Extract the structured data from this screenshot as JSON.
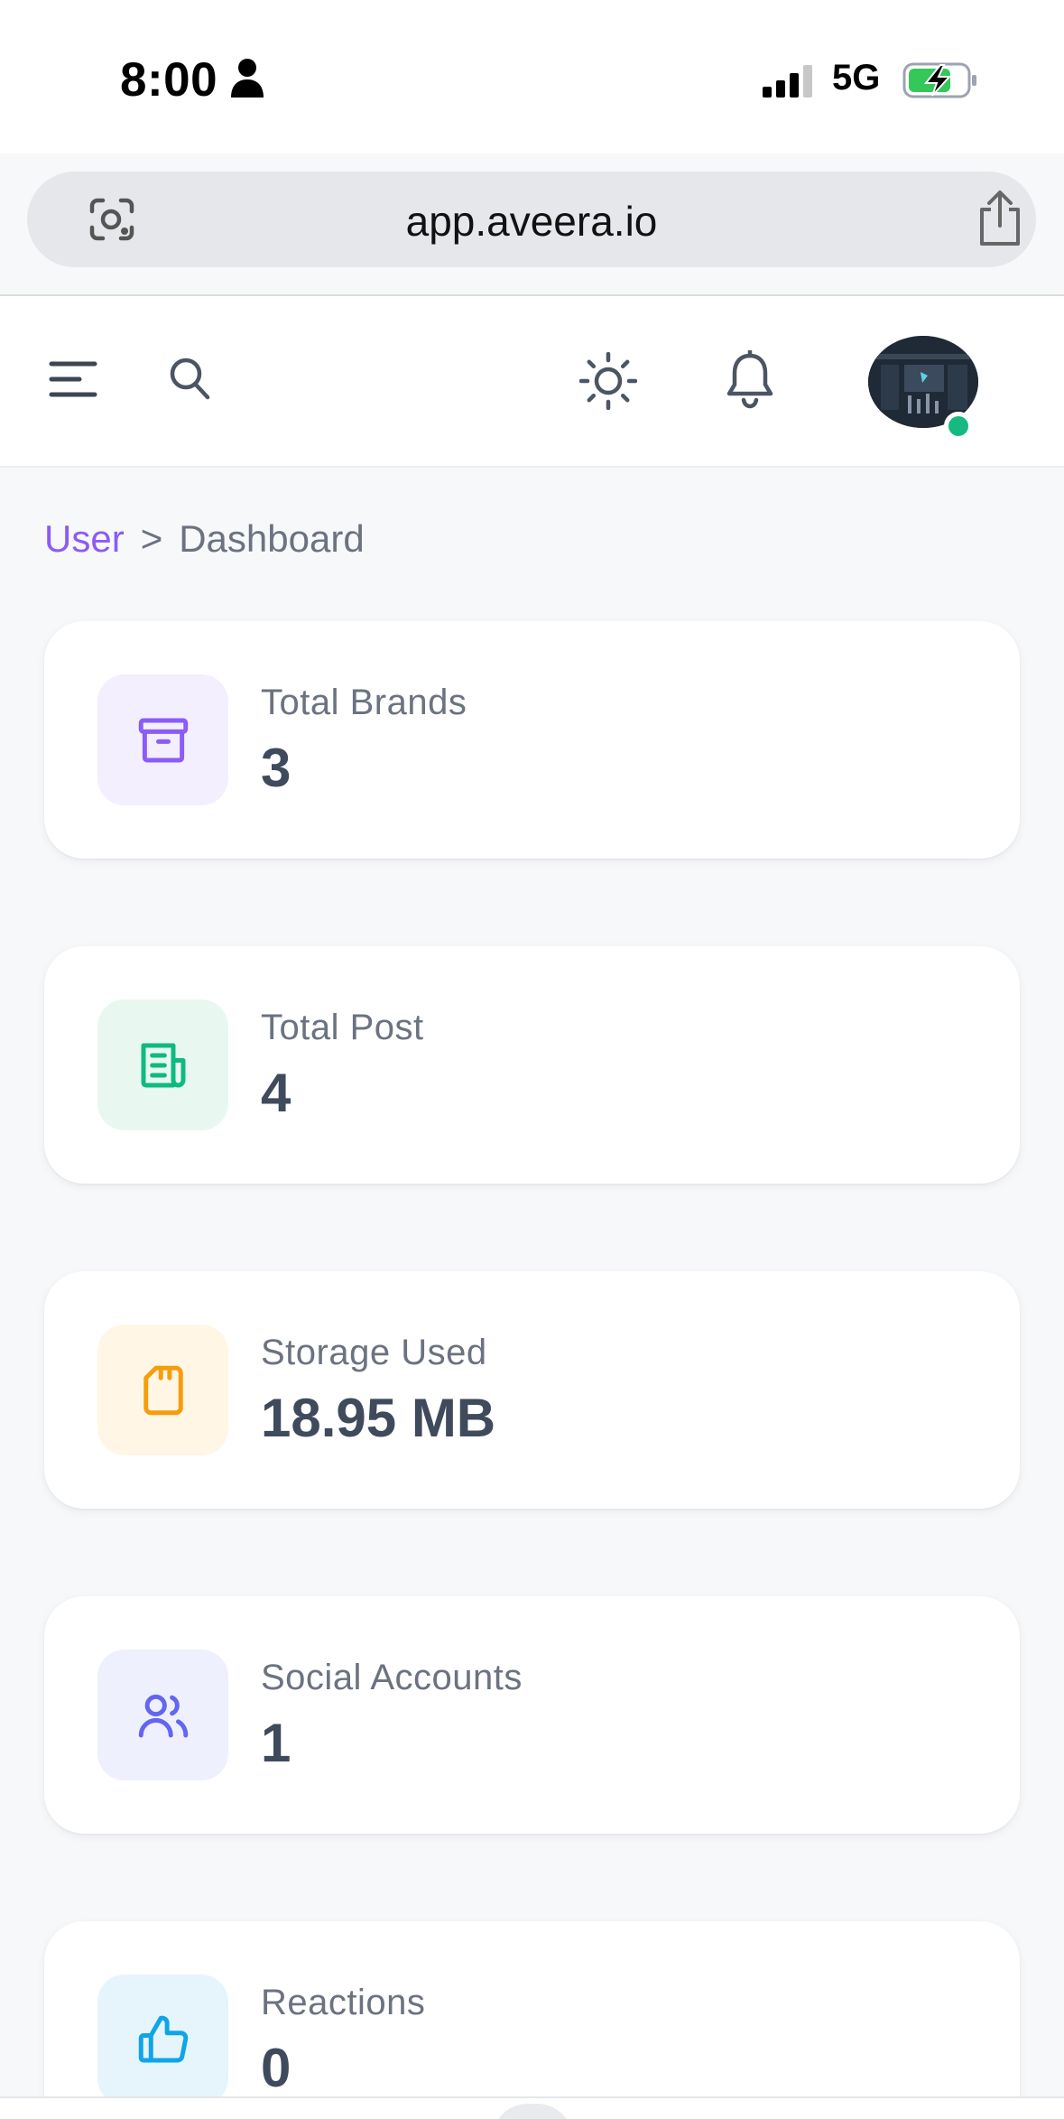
{
  "status_bar": {
    "time": "8:00",
    "network": "5G"
  },
  "browser": {
    "url": "app.aveera.io"
  },
  "breadcrumb": {
    "parent": "User",
    "separator": ">",
    "current": "Dashboard"
  },
  "colors": {
    "accent_purple": "#8b5cf6",
    "online_green": "#16b981"
  },
  "cards": [
    {
      "label": "Total Brands",
      "value": "3",
      "icon": "archive-box-icon",
      "icon_color": "#8b5cf6",
      "icon_bg": "#f3efff"
    },
    {
      "label": "Total Post",
      "value": "4",
      "icon": "newspaper-icon",
      "icon_color": "#10b981",
      "icon_bg": "#e8f8f1"
    },
    {
      "label": "Storage Used",
      "value": "18.95 MB",
      "icon": "sd-card-icon",
      "icon_color": "#f59e0b",
      "icon_bg": "#fff6e6"
    },
    {
      "label": "Social Accounts",
      "value": "1",
      "icon": "users-icon",
      "icon_color": "#6366f1",
      "icon_bg": "#eff0fe"
    },
    {
      "label": "Reactions",
      "value": "0",
      "icon": "thumbs-up-icon",
      "icon_color": "#0ea5e9",
      "icon_bg": "#e6f5fc"
    }
  ]
}
